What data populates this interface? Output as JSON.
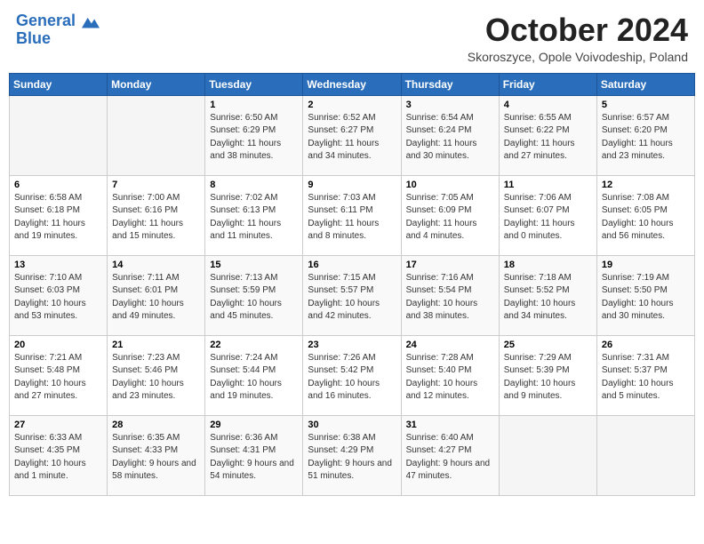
{
  "header": {
    "logo_line1": "General",
    "logo_line2": "Blue",
    "month": "October 2024",
    "location": "Skoroszyce, Opole Voivodeship, Poland"
  },
  "weekdays": [
    "Sunday",
    "Monday",
    "Tuesday",
    "Wednesday",
    "Thursday",
    "Friday",
    "Saturday"
  ],
  "weeks": [
    [
      {
        "day": "",
        "info": ""
      },
      {
        "day": "",
        "info": ""
      },
      {
        "day": "1",
        "info": "Sunrise: 6:50 AM\nSunset: 6:29 PM\nDaylight: 11 hours and 38 minutes."
      },
      {
        "day": "2",
        "info": "Sunrise: 6:52 AM\nSunset: 6:27 PM\nDaylight: 11 hours and 34 minutes."
      },
      {
        "day": "3",
        "info": "Sunrise: 6:54 AM\nSunset: 6:24 PM\nDaylight: 11 hours and 30 minutes."
      },
      {
        "day": "4",
        "info": "Sunrise: 6:55 AM\nSunset: 6:22 PM\nDaylight: 11 hours and 27 minutes."
      },
      {
        "day": "5",
        "info": "Sunrise: 6:57 AM\nSunset: 6:20 PM\nDaylight: 11 hours and 23 minutes."
      }
    ],
    [
      {
        "day": "6",
        "info": "Sunrise: 6:58 AM\nSunset: 6:18 PM\nDaylight: 11 hours and 19 minutes."
      },
      {
        "day": "7",
        "info": "Sunrise: 7:00 AM\nSunset: 6:16 PM\nDaylight: 11 hours and 15 minutes."
      },
      {
        "day": "8",
        "info": "Sunrise: 7:02 AM\nSunset: 6:13 PM\nDaylight: 11 hours and 11 minutes."
      },
      {
        "day": "9",
        "info": "Sunrise: 7:03 AM\nSunset: 6:11 PM\nDaylight: 11 hours and 8 minutes."
      },
      {
        "day": "10",
        "info": "Sunrise: 7:05 AM\nSunset: 6:09 PM\nDaylight: 11 hours and 4 minutes."
      },
      {
        "day": "11",
        "info": "Sunrise: 7:06 AM\nSunset: 6:07 PM\nDaylight: 11 hours and 0 minutes."
      },
      {
        "day": "12",
        "info": "Sunrise: 7:08 AM\nSunset: 6:05 PM\nDaylight: 10 hours and 56 minutes."
      }
    ],
    [
      {
        "day": "13",
        "info": "Sunrise: 7:10 AM\nSunset: 6:03 PM\nDaylight: 10 hours and 53 minutes."
      },
      {
        "day": "14",
        "info": "Sunrise: 7:11 AM\nSunset: 6:01 PM\nDaylight: 10 hours and 49 minutes."
      },
      {
        "day": "15",
        "info": "Sunrise: 7:13 AM\nSunset: 5:59 PM\nDaylight: 10 hours and 45 minutes."
      },
      {
        "day": "16",
        "info": "Sunrise: 7:15 AM\nSunset: 5:57 PM\nDaylight: 10 hours and 42 minutes."
      },
      {
        "day": "17",
        "info": "Sunrise: 7:16 AM\nSunset: 5:54 PM\nDaylight: 10 hours and 38 minutes."
      },
      {
        "day": "18",
        "info": "Sunrise: 7:18 AM\nSunset: 5:52 PM\nDaylight: 10 hours and 34 minutes."
      },
      {
        "day": "19",
        "info": "Sunrise: 7:19 AM\nSunset: 5:50 PM\nDaylight: 10 hours and 30 minutes."
      }
    ],
    [
      {
        "day": "20",
        "info": "Sunrise: 7:21 AM\nSunset: 5:48 PM\nDaylight: 10 hours and 27 minutes."
      },
      {
        "day": "21",
        "info": "Sunrise: 7:23 AM\nSunset: 5:46 PM\nDaylight: 10 hours and 23 minutes."
      },
      {
        "day": "22",
        "info": "Sunrise: 7:24 AM\nSunset: 5:44 PM\nDaylight: 10 hours and 19 minutes."
      },
      {
        "day": "23",
        "info": "Sunrise: 7:26 AM\nSunset: 5:42 PM\nDaylight: 10 hours and 16 minutes."
      },
      {
        "day": "24",
        "info": "Sunrise: 7:28 AM\nSunset: 5:40 PM\nDaylight: 10 hours and 12 minutes."
      },
      {
        "day": "25",
        "info": "Sunrise: 7:29 AM\nSunset: 5:39 PM\nDaylight: 10 hours and 9 minutes."
      },
      {
        "day": "26",
        "info": "Sunrise: 7:31 AM\nSunset: 5:37 PM\nDaylight: 10 hours and 5 minutes."
      }
    ],
    [
      {
        "day": "27",
        "info": "Sunrise: 6:33 AM\nSunset: 4:35 PM\nDaylight: 10 hours and 1 minute."
      },
      {
        "day": "28",
        "info": "Sunrise: 6:35 AM\nSunset: 4:33 PM\nDaylight: 9 hours and 58 minutes."
      },
      {
        "day": "29",
        "info": "Sunrise: 6:36 AM\nSunset: 4:31 PM\nDaylight: 9 hours and 54 minutes."
      },
      {
        "day": "30",
        "info": "Sunrise: 6:38 AM\nSunset: 4:29 PM\nDaylight: 9 hours and 51 minutes."
      },
      {
        "day": "31",
        "info": "Sunrise: 6:40 AM\nSunset: 4:27 PM\nDaylight: 9 hours and 47 minutes."
      },
      {
        "day": "",
        "info": ""
      },
      {
        "day": "",
        "info": ""
      }
    ]
  ]
}
